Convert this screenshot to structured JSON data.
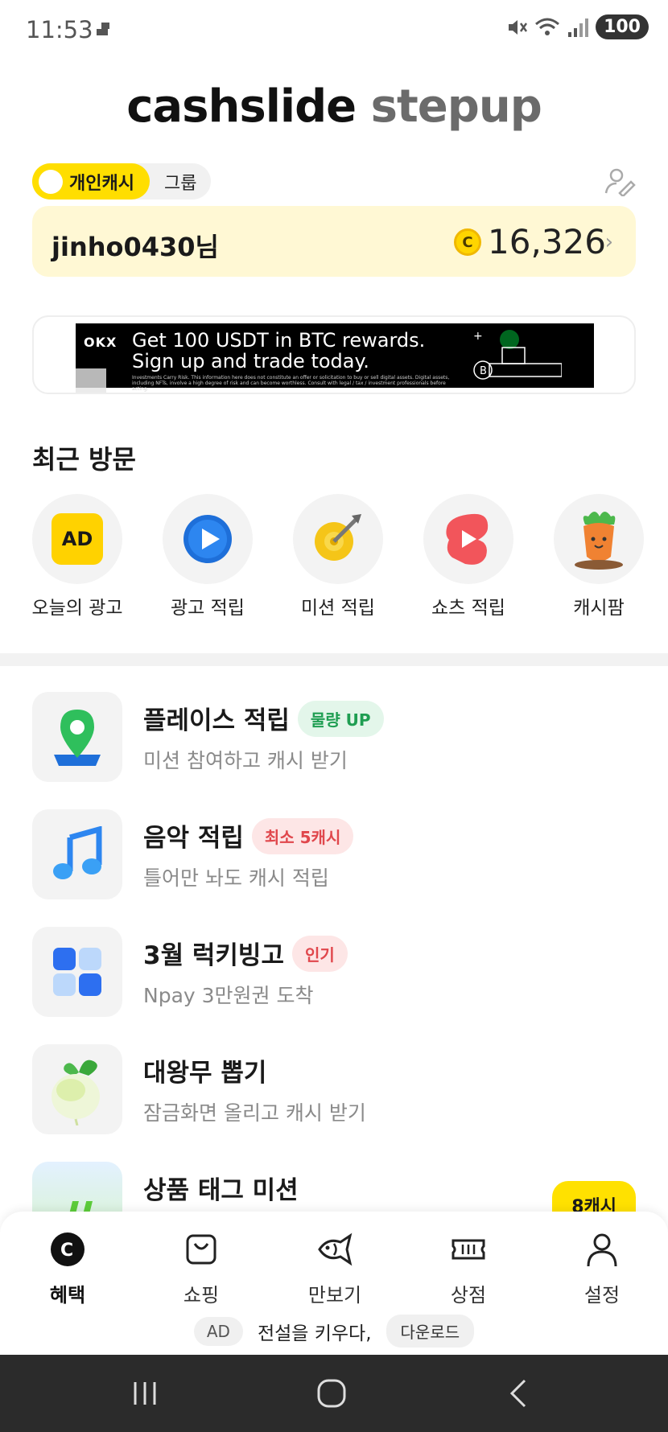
{
  "status_bar": {
    "time": "11:53",
    "battery": "100"
  },
  "brand": {
    "part1": "cashslide",
    "part2": "stepup"
  },
  "toggle": {
    "active": "개인캐시",
    "inactive": "그룹"
  },
  "user": {
    "name": "jinho0430님",
    "coin_symbol": "C",
    "points": "16,326"
  },
  "ad_banner": {
    "logo": "OKX",
    "headline": "Get 100 USDT in BTC rewards. Sign up and trade today.",
    "disclaimer": "Investments Carry Risk. This information here does not constitute an offer or solicitation to buy or sell digital assets. Digital assets, including NFTs, involve a high degree of risk and can become worthless. Consult with legal / tax / investment professionals before acting."
  },
  "recent": {
    "title": "최근 방문",
    "items": [
      {
        "label": "오늘의 광고",
        "icon": "ad-icon",
        "text": "AD"
      },
      {
        "label": "광고 적립",
        "icon": "play-icon"
      },
      {
        "label": "미션 적립",
        "icon": "target-icon"
      },
      {
        "label": "쇼츠 적립",
        "icon": "shorts-icon"
      },
      {
        "label": "캐시팜",
        "icon": "carrot-icon"
      }
    ]
  },
  "features": [
    {
      "title": "플레이스 적립",
      "badge": "물량 UP",
      "subtitle": "미션 참여하고 캐시 받기",
      "icon": "map-pin-icon"
    },
    {
      "title": "음악 적립",
      "badge": "최소 5캐시",
      "subtitle": "틀어만 놔도 캐시 적립",
      "icon": "music-note-icon"
    },
    {
      "title": "3월 럭키빙고",
      "badge": "인기",
      "subtitle": "Npay 3만원권 도착",
      "icon": "bingo-grid-icon"
    },
    {
      "title": "대왕무 뽑기",
      "subtitle": "잠금화면 올리고 캐시 받기",
      "icon": "radish-icon"
    },
    {
      "title": "상품 태그 미션",
      "reward": "8캐시",
      "icon": "hashtag-icon"
    }
  ],
  "bottom_nav": [
    {
      "label": "혜택",
      "icon": "benefit-coin-icon",
      "active": true
    },
    {
      "label": "쇼핑",
      "icon": "shopping-bag-icon"
    },
    {
      "label": "만보기",
      "icon": "fish-icon"
    },
    {
      "label": "상점",
      "icon": "ticket-icon"
    },
    {
      "label": "설정",
      "icon": "person-icon"
    }
  ],
  "ad_strip": {
    "badge": "AD",
    "text": "전설을 키우다,",
    "cta": "다운로드"
  },
  "colors": {
    "accent": "#ffde00",
    "card_bg": "#fff8d4",
    "green_badge": "#1f9e52",
    "red_badge": "#e0474c"
  }
}
